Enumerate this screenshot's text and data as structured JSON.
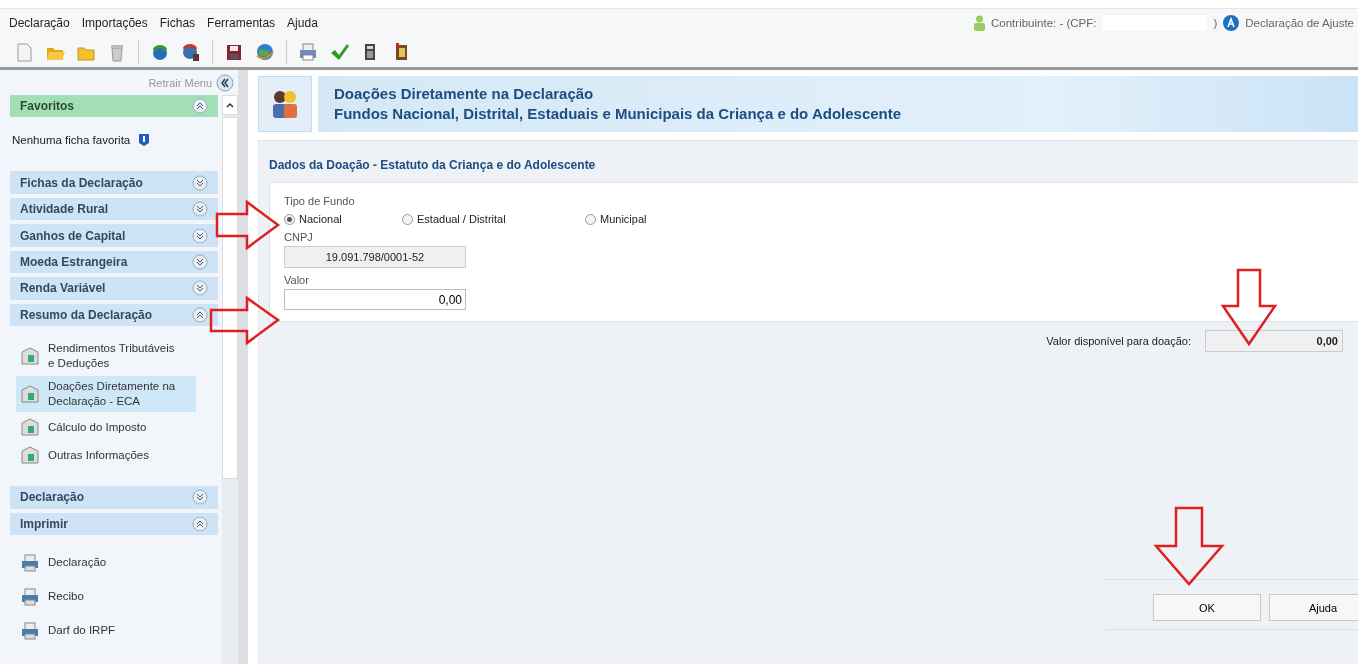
{
  "menu_bar": {
    "items": [
      "Declaração",
      "Importações",
      "Fichas",
      "Ferramentas",
      "Ajuda"
    ],
    "taxpayer_label": "Contribuinte:  - (CPF:",
    "taxpayer_close": ")",
    "declaration_type": "Declaração de Ajuste"
  },
  "sidebar": {
    "collapse_label": "Retrair Menu",
    "sections": [
      {
        "kind": "favorites",
        "title": "Favoritos",
        "expanded": true,
        "empty_text": "Nenhuma ficha favorita"
      },
      {
        "kind": "group",
        "title": "Fichas da Declaração",
        "expanded": false
      },
      {
        "kind": "group",
        "title": "Atividade Rural",
        "expanded": false
      },
      {
        "kind": "group",
        "title": "Ganhos de Capital",
        "expanded": false
      },
      {
        "kind": "group",
        "title": "Moeda Estrangeira",
        "expanded": false
      },
      {
        "kind": "group",
        "title": "Renda Variável",
        "expanded": false
      },
      {
        "kind": "group",
        "title": "Resumo da Declaração",
        "expanded": true,
        "items": [
          {
            "label": "Rendimentos Tributáveis e Deduções",
            "selected": false
          },
          {
            "label": "Doações Diretamente na Declaração - ECA",
            "selected": true
          },
          {
            "label": "Cálculo do Imposto",
            "selected": false
          },
          {
            "label": "Outras Informações",
            "selected": false
          }
        ]
      },
      {
        "kind": "group",
        "title": "Declaração",
        "expanded": false
      },
      {
        "kind": "group",
        "title": "Imprimir",
        "expanded": true,
        "items": [
          {
            "label": "Declaração",
            "selected": false
          },
          {
            "label": "Recibo",
            "selected": false
          },
          {
            "label": "Darf do IRPF",
            "selected": false
          }
        ]
      }
    ]
  },
  "header": {
    "title": "Doações Diretamente na Declaração",
    "subtitle": "Fundos Nacional, Distrital, Estaduais e Municipais da Criança e do Adolescente"
  },
  "form": {
    "section_title": "Dados da Doação - Estatuto da Criança e do Adolescente",
    "fund_type_label": "Tipo de Fundo",
    "fund_types": [
      {
        "label": "Nacional",
        "selected": true
      },
      {
        "label": "Estadual / Distrital",
        "selected": false
      },
      {
        "label": "Municipal",
        "selected": false
      }
    ],
    "cnpj_label": "CNPJ",
    "cnpj_value": "19.091.798/0001-52",
    "valor_label": "Valor",
    "valor_value": "0,00",
    "available_label": "Valor disponível para doação:",
    "available_value": "0,00"
  },
  "buttons": [
    "OK",
    "Ajuda"
  ]
}
